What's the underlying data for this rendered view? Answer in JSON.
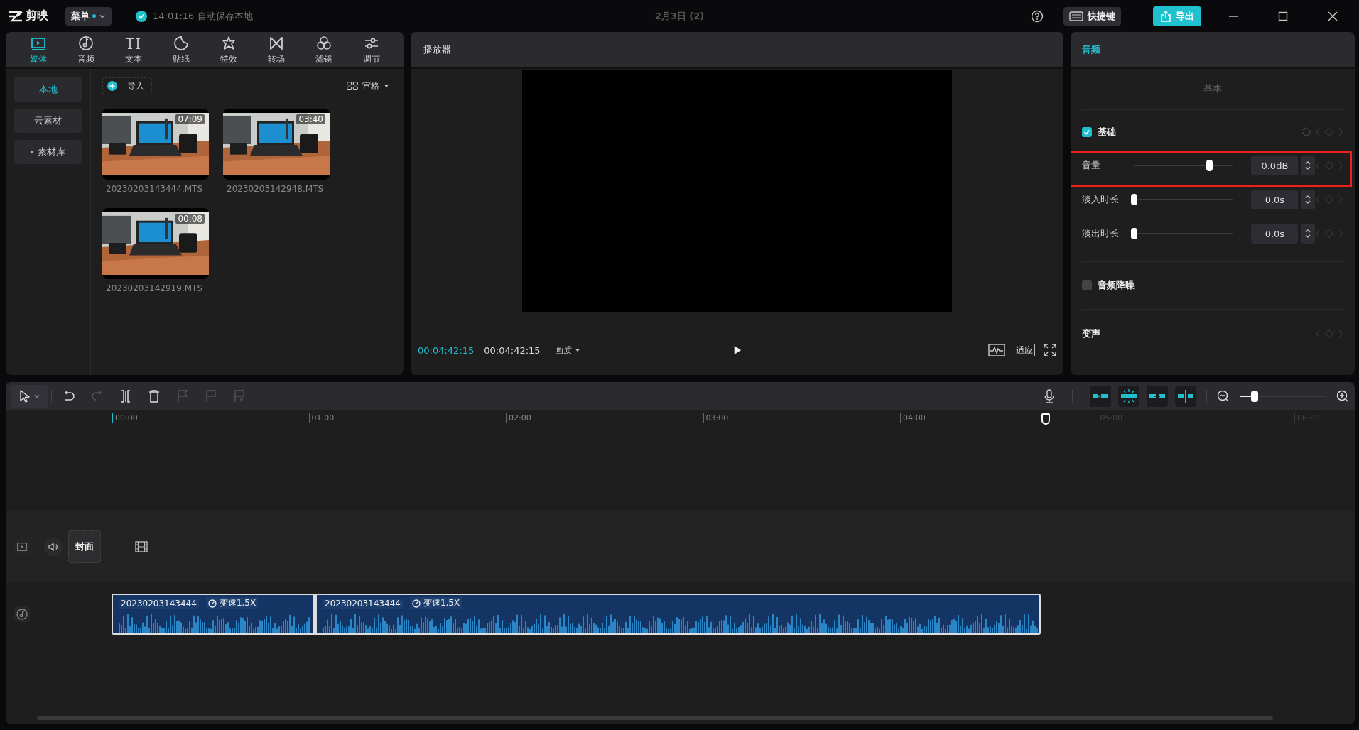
{
  "app": {
    "name": "剪映"
  },
  "menu_button": {
    "label": "菜单"
  },
  "autosave": {
    "text": "14:01:16 自动保存本地"
  },
  "project_title": "2月3日 (2)",
  "top_actions": {
    "shortcuts": "快捷键",
    "export": "导出"
  },
  "media_tabs": [
    {
      "label": "媒体",
      "kind": "media",
      "selected": true
    },
    {
      "label": "音频",
      "kind": "audio",
      "selected": false
    },
    {
      "label": "文本",
      "kind": "text",
      "selected": false
    },
    {
      "label": "贴纸",
      "kind": "sticker",
      "selected": false
    },
    {
      "label": "特效",
      "kind": "effect",
      "selected": false
    },
    {
      "label": "转场",
      "kind": "transition",
      "selected": false
    },
    {
      "label": "滤镜",
      "kind": "filter",
      "selected": false
    },
    {
      "label": "调节",
      "kind": "adjust",
      "selected": false
    }
  ],
  "source_nav": [
    {
      "label": "本地",
      "selected": true,
      "expandable": false
    },
    {
      "label": "云素材",
      "selected": false,
      "expandable": false
    },
    {
      "label": "素材库",
      "selected": false,
      "expandable": true
    }
  ],
  "import_button": {
    "label": "导入"
  },
  "view_mode": {
    "label": "宫格"
  },
  "media_items": [
    {
      "name": "20230203143444.MTS",
      "duration": "07:09"
    },
    {
      "name": "20230203142948.MTS",
      "duration": "03:40"
    },
    {
      "name": "20230203142919.MTS",
      "duration": "00:08"
    }
  ],
  "player": {
    "title": "播放器",
    "current_time": "00:04:42:15",
    "total_time": "00:04:42:15",
    "quality": "画质",
    "fit": "适应"
  },
  "inspector": {
    "tab": "音频",
    "section": "基本",
    "basic": {
      "label": "基础",
      "checked": true
    },
    "sliders": [
      {
        "label": "音量",
        "level": 0.76,
        "value": "0.0dB",
        "highlighted": true
      },
      {
        "label": "淡入时长",
        "level": 0,
        "value": "0.0s",
        "highlighted": false
      },
      {
        "label": "淡出时长",
        "level": 0,
        "value": "0.0s",
        "highlighted": false
      }
    ],
    "denoise": {
      "label": "音频降噪",
      "checked": false
    },
    "voice_change": {
      "label": "变声"
    }
  },
  "timeline": {
    "zoom": {
      "level": 0.17
    },
    "ruler": [
      {
        "label": "00:00",
        "dim": false
      },
      {
        "label": "01:00",
        "dim": false
      },
      {
        "label": "02:00",
        "dim": false
      },
      {
        "label": "03:00",
        "dim": false
      },
      {
        "label": "04:00",
        "dim": false
      },
      {
        "label": "05:00",
        "dim": true
      },
      {
        "label": "06:00",
        "dim": true
      }
    ],
    "cover": "封面",
    "clips": [
      {
        "name": "20230203143444",
        "speed": "变速1.5X"
      },
      {
        "name": "20230203143444",
        "speed": "变速1.5X"
      }
    ]
  }
}
